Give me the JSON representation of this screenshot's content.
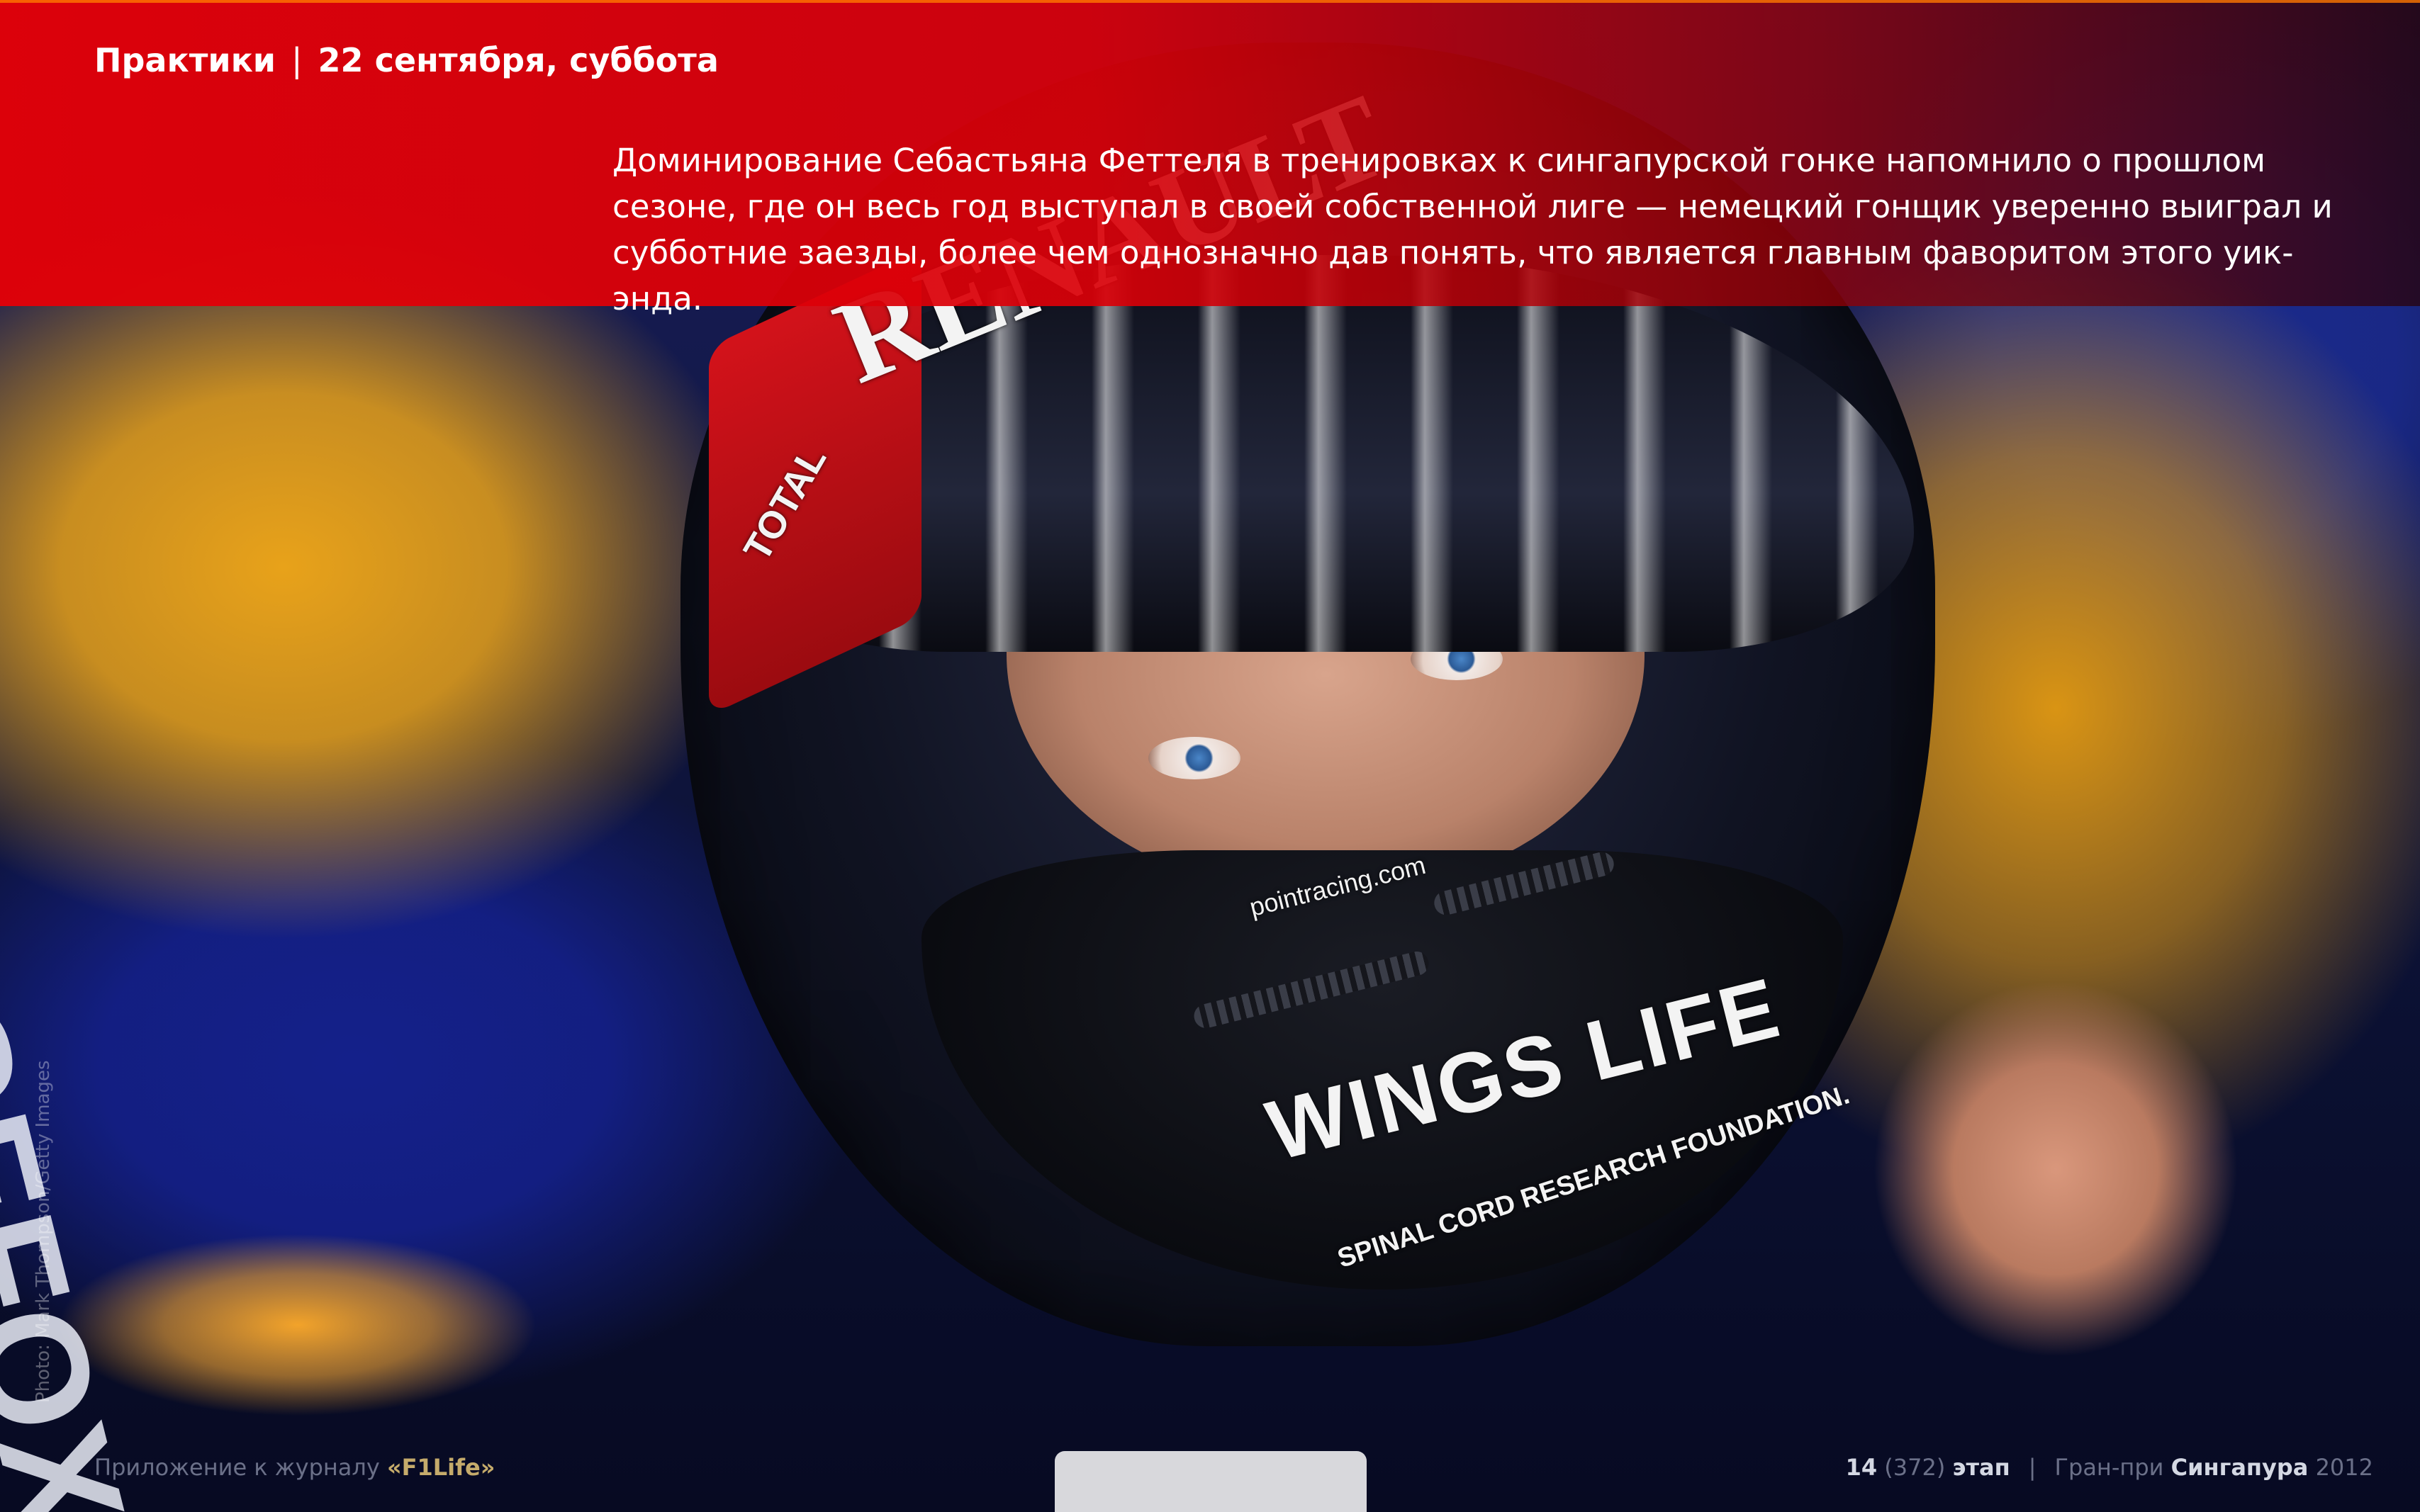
{
  "header": {
    "section": "Практики",
    "separator": "|",
    "date": "22 сентября, суббота",
    "lead": "Доминирование Себастьяна Феттеля в тренировках к сингапурской гонке напомнило о прошлом сезоне, где он весь год выступал в своей собственной лиге — немецкий гонщик уверенно выиграл и субботние заезды, более чем однозначно дав понять, что является главным фаворитом этого уик-энда."
  },
  "photo": {
    "credit": "Photo: Mark Thompson/Getty Images",
    "helmet_brand_1": "RENAULT",
    "helmet_brand_2": "TOTAL",
    "helmet_sponsor_site": "pointracing.com",
    "helmet_logo": "WINGS LIFE",
    "helmet_logo_sub": "SPINAL CORD RESEARCH FOUNDATION.",
    "car_sponsor": "GEFOX",
    "colors": {
      "band_red": "#e20008",
      "car_blue": "#14208a",
      "car_yellow": "#e8a21a"
    }
  },
  "footer": {
    "left_prefix": "Приложение к журналу ",
    "left_brand": "«F1Life»",
    "stage_num": "14",
    "stage_total": "(372)",
    "stage_word": "этап",
    "separator": "|",
    "gp_prefix": "Гран-при ",
    "gp_name": "Сингапура",
    "year": "2012"
  }
}
